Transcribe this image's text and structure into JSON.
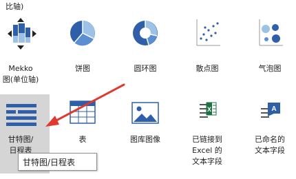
{
  "gallery": {
    "top_fragment": "比轴)",
    "tiles": [
      {
        "label_lines": [
          "Mekko",
          "图(单位轴)"
        ],
        "icon": "mekko-chart-icon"
      },
      {
        "label_lines": [
          "饼图"
        ],
        "icon": "pie-chart-icon"
      },
      {
        "label_lines": [
          "圆环图"
        ],
        "icon": "donut-chart-icon"
      },
      {
        "label_lines": [
          "散点图"
        ],
        "icon": "scatter-chart-icon"
      },
      {
        "label_lines": [
          "气泡图"
        ],
        "icon": "bubble-chart-icon"
      },
      {
        "label_lines": [
          "甘特图/",
          "日程表"
        ],
        "icon": "gantt-chart-icon"
      },
      {
        "label_lines": [
          "表"
        ],
        "icon": "table-icon"
      },
      {
        "label_lines": [
          "图库图像"
        ],
        "icon": "picture-gallery-icon"
      },
      {
        "label_lines": [
          "已链接到",
          "Excel 的",
          "文本字段"
        ],
        "icon": "excel-linked-text-icon"
      },
      {
        "label_lines": [
          "已命名的",
          "文本字段"
        ],
        "icon": "named-text-field-icon"
      }
    ]
  },
  "tooltip": {
    "text": "甘特图/日程表"
  },
  "colors": {
    "accent_blue": "#2e5fa8",
    "light_blue": "#9ec1e6",
    "selected_bg": "#d5d5d5",
    "arrow_red": "#e03a2f",
    "excel_green": "#1e7145"
  }
}
